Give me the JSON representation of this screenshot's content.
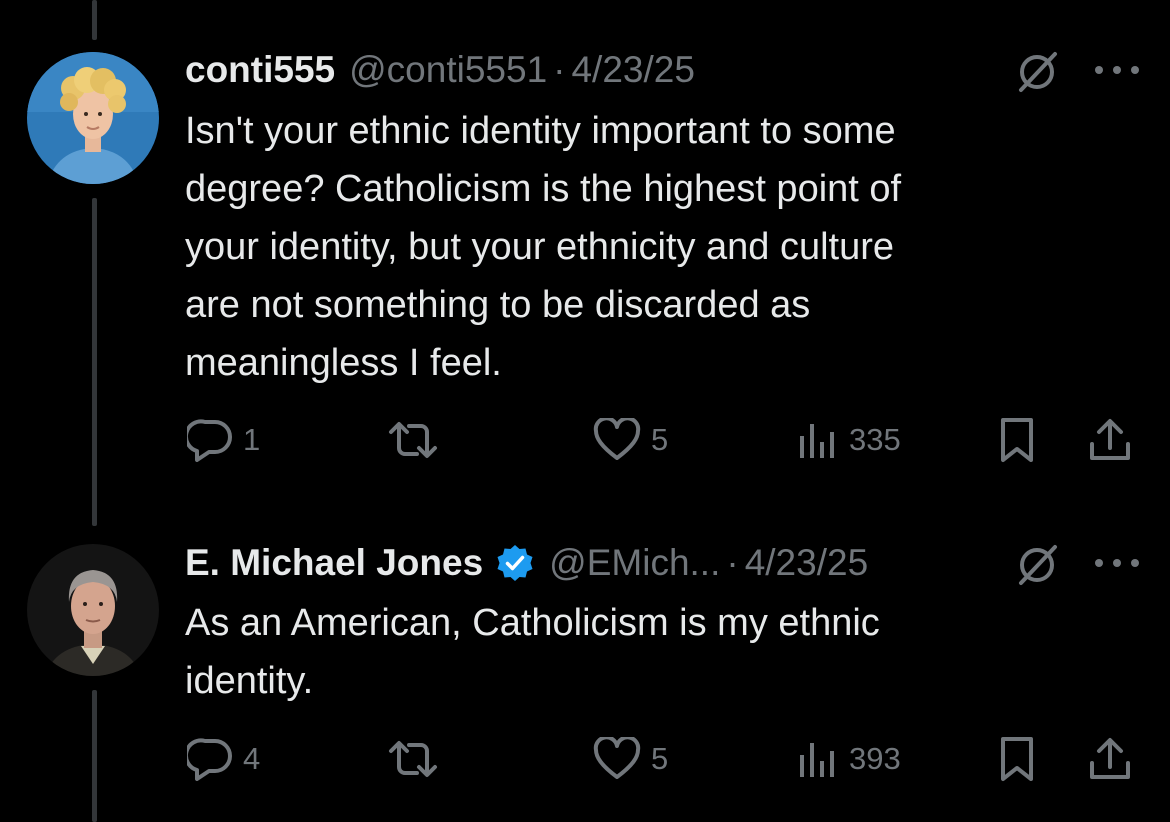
{
  "tweets": [
    {
      "name": "conti555",
      "verified": false,
      "handle": "@conti5551",
      "date": "4/23/25",
      "text_lines": [
        "Isn't your ethnic identity important to some",
        "degree? Catholicism is the highest point of",
        "your identity, but your ethnicity and culture",
        "are not something to be discarded as",
        "meaningless I feel."
      ],
      "reply_count": "1",
      "like_count": "5",
      "view_count": "335"
    },
    {
      "name": "E. Michael Jones",
      "verified": true,
      "handle": "@EMich...",
      "date": "4/23/25",
      "text_lines": [
        "As an American, Catholicism is my ethnic",
        "identity."
      ],
      "reply_count": "4",
      "like_count": "5",
      "view_count": "393"
    }
  ],
  "colors": {
    "background": "#000000",
    "text_primary": "#e7e9ea",
    "text_secondary": "#71767b",
    "verified_badge": "#1d9bf0",
    "thread_line": "#333639"
  },
  "icons": [
    "reply-icon",
    "retweet-icon",
    "like-icon",
    "views-icon",
    "bookmark-icon",
    "share-icon",
    "grok-icon",
    "more-icon",
    "verified-badge-icon"
  ]
}
